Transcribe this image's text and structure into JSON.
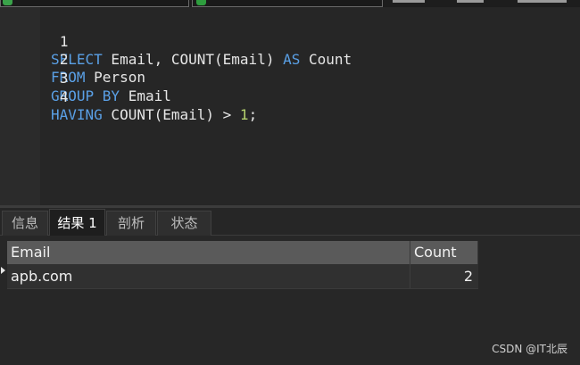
{
  "editor": {
    "lines": [
      {
        "num": "1",
        "tokens": [
          {
            "t": "SELECT",
            "k": "kw"
          },
          {
            "t": " Email, COUNT(Email) ",
            "k": "id"
          },
          {
            "t": "AS",
            "k": "kw"
          },
          {
            "t": " Count",
            "k": "id"
          }
        ]
      },
      {
        "num": "2",
        "tokens": [
          {
            "t": "FROM",
            "k": "kw"
          },
          {
            "t": " Person",
            "k": "id"
          }
        ]
      },
      {
        "num": "3",
        "tokens": [
          {
            "t": "GROUP BY",
            "k": "kw"
          },
          {
            "t": " Email",
            "k": "id"
          }
        ]
      },
      {
        "num": "4",
        "tokens": [
          {
            "t": "HAVING",
            "k": "kw"
          },
          {
            "t": " COUNT(Email) > ",
            "k": "id"
          },
          {
            "t": "1",
            "k": "num"
          },
          {
            "t": ";",
            "k": "id"
          }
        ]
      }
    ]
  },
  "tabs": [
    {
      "label": "信息",
      "active": false
    },
    {
      "label": "结果 1",
      "active": true
    },
    {
      "label": "剖析",
      "active": false
    },
    {
      "label": "状态",
      "active": false
    }
  ],
  "results": {
    "columns": [
      "Email",
      "Count"
    ],
    "rows": [
      {
        "email": "apb.com",
        "count": "2"
      }
    ]
  },
  "watermark": "CSDN @IT北辰",
  "colors": {
    "background": "#262626",
    "keyword": "#5aa0e6",
    "number": "#b6d36e",
    "header_bg": "#5a5a5a"
  }
}
